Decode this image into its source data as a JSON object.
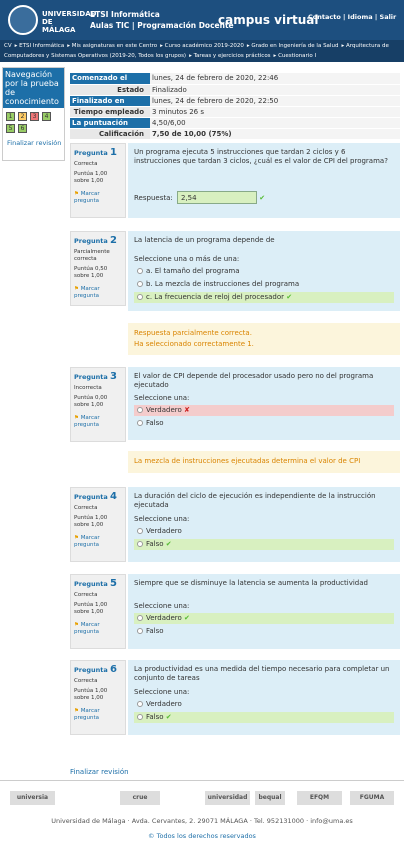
{
  "header": {
    "logo_text": "UNIVERSIDAD DE MÁLAGA",
    "site": "ETSI Informática",
    "sub": "Aulas TIC | Programación Docente",
    "brand": "campus virtual",
    "links": "Contacto | Idioma | Salir"
  },
  "breadcrumb": [
    "CV",
    "ETSI Informática",
    "Mis asignaturas en este Centro",
    "Curso académico 2019-2020",
    "Grado en Ingeniería de la Salud",
    "Arquitectura de Computadores y Sistemas Operativos (2019-20, Todos los grupos)",
    "Tareas y ejercicios prácticos",
    "Cuestionario I"
  ],
  "nav": {
    "title": "Navegación por la prueba de conocimiento",
    "buttons": [
      "1",
      "2",
      "3",
      "4",
      "5",
      "6"
    ],
    "finish": "Finalizar revisión"
  },
  "summary": [
    [
      "Comenzado el",
      "lunes, 24 de febrero de 2020, 22:46"
    ],
    [
      "Estado",
      "Finalizado"
    ],
    [
      "Finalizado en",
      "lunes, 24 de febrero de 2020, 22:50"
    ],
    [
      "Tiempo empleado",
      "3 minutos 26 s"
    ],
    [
      "La puntuación",
      "4,50/6,00"
    ],
    [
      "Calificación",
      "7,50 de 10,00 (75%)"
    ]
  ],
  "questions": [
    {
      "num": "1",
      "state": "Correcta",
      "score": "Puntúa 1,00 sobre 1,00",
      "flag": "Marcar pregunta",
      "text": "Un programa ejecuta 5 instrucciones que tardan 2 ciclos y 6 instrucciones que tardan 3 ciclos, ¿cuál es el valor de CPI del programa?",
      "answer_label": "Respuesta:",
      "answer": "2,54"
    },
    {
      "num": "2",
      "state": "Parcialmente correcta",
      "score": "Puntúa 0,50 sobre 1,00",
      "flag": "Marcar pregunta",
      "text": "La latencia de un programa depende de",
      "prompt": "Seleccione una o más de una:",
      "options": [
        "a. El tamaño del programa",
        "b. La mezcla de instrucciones del programa",
        "c. La frecuencia de reloj del procesador"
      ],
      "fb1": "Respuesta parcialmente correcta.",
      "fb2": "Ha seleccionado correctamente 1."
    },
    {
      "num": "3",
      "state": "Incorrecta",
      "score": "Puntúa 0,00 sobre 1,00",
      "flag": "Marcar pregunta",
      "text": "El valor de CPI depende del procesador usado pero no del programa ejecutado",
      "prompt": "Seleccione una:",
      "options": [
        "Verdadero",
        "Falso"
      ],
      "fb1": "La mezcla de instrucciones ejecutadas determina el valor de CPI"
    },
    {
      "num": "4",
      "state": "Correcta",
      "score": "Puntúa 1,00 sobre 1,00",
      "flag": "Marcar pregunta",
      "text": "La duración del ciclo de ejecución es independiente de la instrucción ejecutada",
      "prompt": "Seleccione una:",
      "options": [
        "Verdadero",
        "Falso"
      ]
    },
    {
      "num": "5",
      "state": "Correcta",
      "score": "Puntúa 1,00 sobre 1,00",
      "flag": "Marcar pregunta",
      "text": "Siempre que se disminuye la latencia se aumenta la productividad",
      "prompt": "Seleccione una:",
      "options": [
        "Verdadero",
        "Falso"
      ]
    },
    {
      "num": "6",
      "state": "Correcta",
      "score": "Puntúa 1,00 sobre 1,00",
      "flag": "Marcar pregunta",
      "text": "La productividad es una medida del tiempo necesario para completar un conjunto de tareas",
      "prompt": "Seleccione una:",
      "options": [
        "Verdadero",
        "Falso"
      ]
    }
  ],
  "finish_bottom": "Finalizar revisión",
  "footer": {
    "logos": [
      "universia",
      "crue",
      "universidad",
      "bequal",
      "EFQM",
      "FGUMA"
    ],
    "address": "Universidad de Málaga · Avda. Cervantes, 2. 29071 MÁLAGA · Tel. 952131000 · info@uma.es",
    "copyright": "© Todos los derechos reservados"
  },
  "colors": {
    "header": "#1d4f7f",
    "accent": "#1d6fa8",
    "correct": "#d8f0c0",
    "wrong": "#f4cccc",
    "feedback": "#fcf5dc"
  }
}
